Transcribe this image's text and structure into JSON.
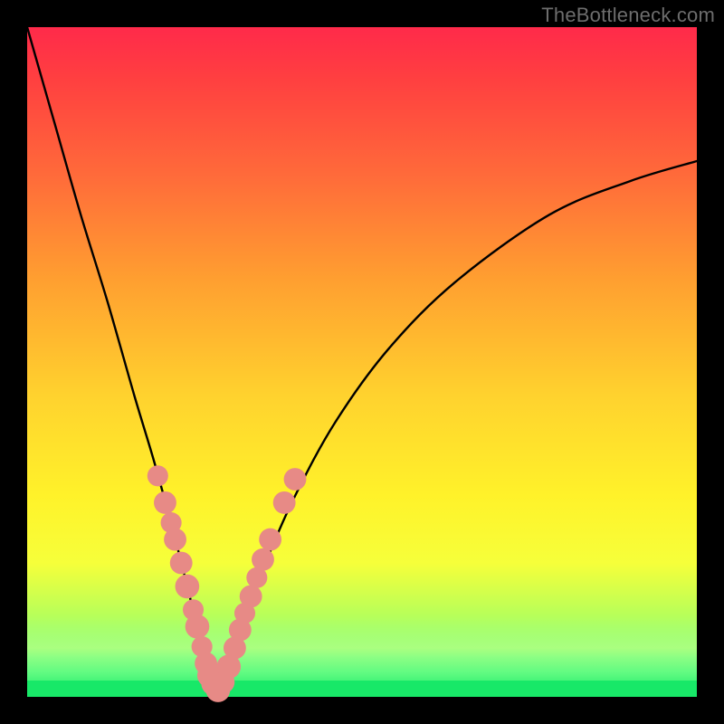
{
  "watermark": "TheBottleneck.com",
  "colors": {
    "background": "#000000",
    "gradient_top": "#ff2a4a",
    "gradient_bottom": "#18e868",
    "curve": "#000000",
    "markers": "#e78a86",
    "watermark": "#6d6d6d"
  },
  "chart_data": {
    "type": "line",
    "title": "",
    "xlabel": "",
    "ylabel": "",
    "xlim": [
      0,
      100
    ],
    "ylim": [
      0,
      100
    ],
    "notes": "V-shaped bottleneck curve. y ≈ 100 at x=0, drops to ~0 at x≈27 (minimum), rises back toward ~80 at x=100. Markers cluster near the trough.",
    "series": [
      {
        "name": "bottleneck-curve",
        "x": [
          0,
          4,
          8,
          12,
          16,
          19,
          22,
          25,
          26,
          27,
          28,
          29,
          31,
          33,
          36,
          40,
          46,
          54,
          64,
          78,
          90,
          100
        ],
        "y": [
          100,
          86,
          72,
          59,
          45,
          35,
          24,
          12,
          7,
          2,
          0,
          2,
          7,
          13,
          21,
          30,
          41,
          52,
          62,
          72,
          77,
          80
        ]
      }
    ],
    "markers": [
      {
        "x": 19.5,
        "y": 33,
        "r": 1.3
      },
      {
        "x": 20.6,
        "y": 29,
        "r": 1.4
      },
      {
        "x": 21.5,
        "y": 26,
        "r": 1.3
      },
      {
        "x": 22.1,
        "y": 23.5,
        "r": 1.4
      },
      {
        "x": 23.0,
        "y": 20,
        "r": 1.4
      },
      {
        "x": 23.9,
        "y": 16.5,
        "r": 1.5
      },
      {
        "x": 24.8,
        "y": 13,
        "r": 1.3
      },
      {
        "x": 25.4,
        "y": 10.5,
        "r": 1.5
      },
      {
        "x": 26.1,
        "y": 7.5,
        "r": 1.3
      },
      {
        "x": 26.7,
        "y": 5,
        "r": 1.4
      },
      {
        "x": 27.2,
        "y": 3.2,
        "r": 1.5
      },
      {
        "x": 27.8,
        "y": 2.0,
        "r": 1.5
      },
      {
        "x": 28.5,
        "y": 1.0,
        "r": 1.5
      },
      {
        "x": 29.3,
        "y": 2.2,
        "r": 1.4
      },
      {
        "x": 30.1,
        "y": 4.5,
        "r": 1.5
      },
      {
        "x": 31.0,
        "y": 7.3,
        "r": 1.4
      },
      {
        "x": 31.8,
        "y": 10,
        "r": 1.4
      },
      {
        "x": 32.5,
        "y": 12.5,
        "r": 1.3
      },
      {
        "x": 33.4,
        "y": 15,
        "r": 1.4
      },
      {
        "x": 34.3,
        "y": 17.8,
        "r": 1.3
      },
      {
        "x": 35.2,
        "y": 20.5,
        "r": 1.4
      },
      {
        "x": 36.3,
        "y": 23.5,
        "r": 1.4
      },
      {
        "x": 38.4,
        "y": 29,
        "r": 1.4
      },
      {
        "x": 40.0,
        "y": 32.5,
        "r": 1.4
      }
    ]
  }
}
